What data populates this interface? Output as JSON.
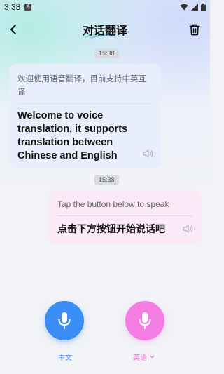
{
  "status_bar": {
    "time": "3:38",
    "app_badge": "A"
  },
  "header": {
    "title": "对话翻译"
  },
  "messages": [
    {
      "timestamp": "15:38",
      "source_text": "欢迎使用语音翻译，目前支持中英互译",
      "translated_text": "Welcome to voice translation, it supports translation between Chinese and English"
    },
    {
      "timestamp": "15:38",
      "source_text": "Tap the button below to speak",
      "translated_text": "点击下方按钮开始说话吧"
    }
  ],
  "controls": {
    "left_language": "中文",
    "right_language": "英语"
  },
  "colors": {
    "blue_accent": "#3c8ef7",
    "pink_accent": "#f37de3"
  },
  "icons": {
    "back": "back-arrow-icon",
    "delete": "trash-icon",
    "speaker": "speaker-icon",
    "mic": "microphone-icon",
    "dropdown": "chevron-down-icon"
  }
}
